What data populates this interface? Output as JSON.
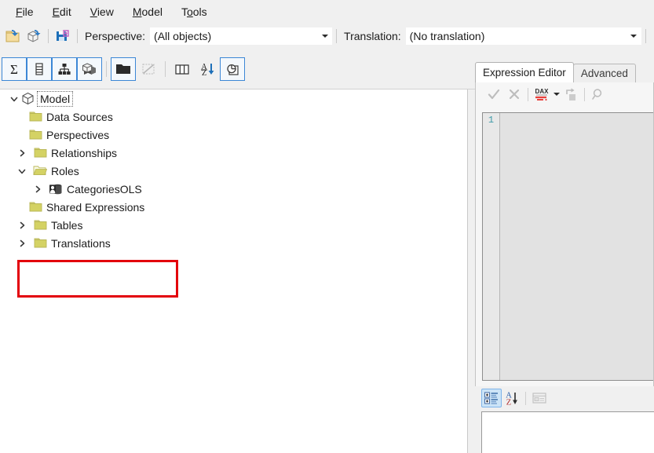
{
  "menu": {
    "items": [
      {
        "name": "file",
        "pre": "",
        "mnemonic": "F",
        "post": "ile"
      },
      {
        "name": "edit",
        "pre": "",
        "mnemonic": "E",
        "post": "dit"
      },
      {
        "name": "view",
        "pre": "",
        "mnemonic": "V",
        "post": "iew"
      },
      {
        "name": "model",
        "pre": "",
        "mnemonic": "M",
        "post": "odel"
      },
      {
        "name": "tools",
        "pre": "T",
        "mnemonic": "o",
        "post": "ols"
      }
    ]
  },
  "toolbar_main": {
    "buttons": [
      {
        "name": "open-file-icon",
        "title": "Open"
      },
      {
        "name": "open-from-server-icon",
        "title": "Open from server"
      },
      {
        "name": "save-icon",
        "title": "Save"
      }
    ],
    "perspective_label": "Perspective:",
    "perspective_value": "(All objects)",
    "translation_label": "Translation:",
    "translation_value": "(No translation)"
  },
  "toolbar_view": {
    "buttons": [
      {
        "name": "measures-icon",
        "title": "Measures",
        "framed": true,
        "disabled": false
      },
      {
        "name": "columns-icon",
        "title": "Columns",
        "framed": true,
        "disabled": false
      },
      {
        "name": "hierarchies-icon",
        "title": "Hierarchies",
        "framed": true,
        "disabled": false
      },
      {
        "name": "partitions-icon",
        "title": "Partitions",
        "framed": true,
        "disabled": false
      },
      {
        "name": "display-folders-icon",
        "title": "Display folders",
        "framed": true,
        "disabled": false
      },
      {
        "name": "hidden-objects-icon",
        "title": "Hidden objects",
        "framed": false,
        "disabled": true
      },
      {
        "name": "all-columns-icon",
        "title": "All columns",
        "framed": false,
        "disabled": false
      },
      {
        "name": "sort-alphabetically-icon",
        "title": "Sort alphabetically",
        "framed": false,
        "disabled": false
      },
      {
        "name": "object-dependencies-icon",
        "title": "Object dependencies",
        "framed": true,
        "disabled": false
      }
    ]
  },
  "tree": {
    "nodes": [
      {
        "name": "model",
        "label": "Model",
        "indent": 0,
        "expander": "expanded",
        "icon": "cube-icon",
        "focused": true
      },
      {
        "name": "data-sources",
        "label": "Data Sources",
        "indent": 1,
        "expander": "none",
        "icon": "folder-icon",
        "focused": false
      },
      {
        "name": "perspectives",
        "label": "Perspectives",
        "indent": 1,
        "expander": "none",
        "icon": "folder-icon",
        "focused": false
      },
      {
        "name": "relationships",
        "label": "Relationships",
        "indent": 1,
        "expander": "collapsed",
        "icon": "folder-icon",
        "focused": false
      },
      {
        "name": "roles",
        "label": "Roles",
        "indent": 1,
        "expander": "expanded",
        "icon": "folder-open-icon",
        "focused": false
      },
      {
        "name": "categoriesols",
        "label": "CategoriesOLS",
        "indent": 2,
        "expander": "collapsed",
        "icon": "role-icon",
        "focused": false
      },
      {
        "name": "shared-expressions",
        "label": "Shared Expressions",
        "indent": 1,
        "expander": "none",
        "icon": "folder-icon",
        "focused": false
      },
      {
        "name": "tables",
        "label": "Tables",
        "indent": 1,
        "expander": "collapsed",
        "icon": "folder-icon",
        "focused": false
      },
      {
        "name": "translations",
        "label": "Translations",
        "indent": 1,
        "expander": "collapsed",
        "icon": "folder-icon",
        "focused": false
      }
    ]
  },
  "annotation": {
    "color": "#e3000b",
    "target": "Roles / CategoriesOLS"
  },
  "right_panel": {
    "tabs": [
      {
        "name": "expression-editor",
        "label": "Expression Editor",
        "active": true
      },
      {
        "name": "advanced",
        "label": "Advanced",
        "active": false
      }
    ],
    "editor_toolbar": [
      {
        "name": "accept-icon",
        "title": "Accept",
        "disabled": true
      },
      {
        "name": "cancel-icon",
        "title": "Cancel",
        "disabled": true
      },
      {
        "name": "dax-formatter-icon",
        "title": "Format DAX",
        "disabled": false
      },
      {
        "name": "dax-formatter-dropdown-icon",
        "title": "Format DAX options",
        "disabled": false
      },
      {
        "name": "expand-expression-icon",
        "title": "Expand",
        "disabled": true
      },
      {
        "name": "search-icon",
        "title": "Search",
        "disabled": true
      }
    ],
    "editor": {
      "line_number": "1",
      "code": ""
    }
  },
  "properties_panel": {
    "buttons": [
      {
        "name": "categorized-view-icon",
        "title": "Categorized",
        "checked": true,
        "disabled": false
      },
      {
        "name": "alphabetical-sort-icon",
        "title": "Alphabetical",
        "checked": false,
        "disabled": false
      },
      {
        "name": "property-pages-icon",
        "title": "Property Pages",
        "checked": false,
        "disabled": true
      }
    ]
  },
  "colors": {
    "window_bg": "#f0f0f0",
    "panel_bg": "#ffffff",
    "folder_yellow": "#d4d264",
    "accent_blue": "#3c87d6",
    "annotation_red": "#e3000b",
    "linenumber_teal": "#3f9aa8",
    "editor_disabled": "#e2e2e2"
  }
}
